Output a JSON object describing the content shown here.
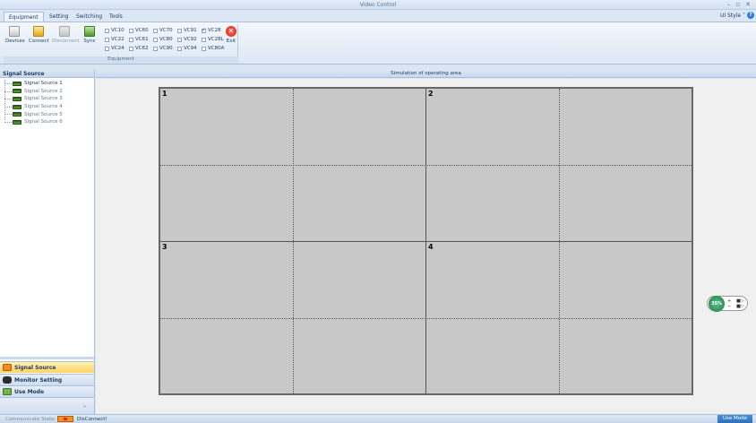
{
  "window": {
    "title": "Video Control",
    "min_glyph": "–",
    "max_glyph": "▫",
    "close_glyph": "✕"
  },
  "tabs": [
    {
      "label": "Equipment",
      "active": true
    },
    {
      "label": "Setting",
      "active": false
    },
    {
      "label": "Switching",
      "active": false
    },
    {
      "label": "Tools",
      "active": false
    }
  ],
  "style_menu": "UI Style ˅",
  "ribbon": {
    "buttons": {
      "devices": "Devices",
      "connect": "Connect",
      "disconnect": "Disconnect",
      "sync": "Sync",
      "exit": "Exit"
    },
    "models": [
      {
        "label": "VC10",
        "checked": false
      },
      {
        "label": "VC60",
        "checked": false
      },
      {
        "label": "VC70",
        "checked": false
      },
      {
        "label": "VC91",
        "checked": false
      },
      {
        "label": "VC28",
        "checked": true
      },
      {
        "label": "VC22",
        "checked": false
      },
      {
        "label": "VC61",
        "checked": false
      },
      {
        "label": "VC80",
        "checked": false
      },
      {
        "label": "VC92",
        "checked": false
      },
      {
        "label": "VC28L",
        "checked": false
      },
      {
        "label": "VC24",
        "checked": false
      },
      {
        "label": "VC62",
        "checked": false
      },
      {
        "label": "VC90",
        "checked": false
      },
      {
        "label": "VC94",
        "checked": false
      },
      {
        "label": "VC80A",
        "checked": false
      }
    ],
    "group_caption": "Equipment"
  },
  "left_panel": {
    "title": "Signal Source",
    "items": [
      "Signal Source 1",
      "Signal Source 2",
      "Signal Source 3",
      "Signal Source 4",
      "Signal Source 5",
      "Signal Source 6"
    ],
    "nav": {
      "signal_source": "Signal Source",
      "monitor_setting": "Monitor Setting",
      "use_mode": "Use Mode"
    }
  },
  "work": {
    "header": "Simulation of operating area",
    "screen_labels": [
      "1",
      "2",
      "3",
      "4"
    ]
  },
  "zoom": {
    "value": "35%",
    "ctl_a": "+",
    "ctl_b": "−",
    "ctl_c": "■▷",
    "ctl_d": "■▷"
  },
  "status": {
    "label": "Communicate State:",
    "state": "DisConnect!",
    "mode": "Use Mode"
  },
  "colors": {
    "accent": "#2d6fb8",
    "ribbon_bg": "#dde8f5",
    "screen_bg": "#c8c8c8",
    "active_nav": "#ffd466"
  }
}
